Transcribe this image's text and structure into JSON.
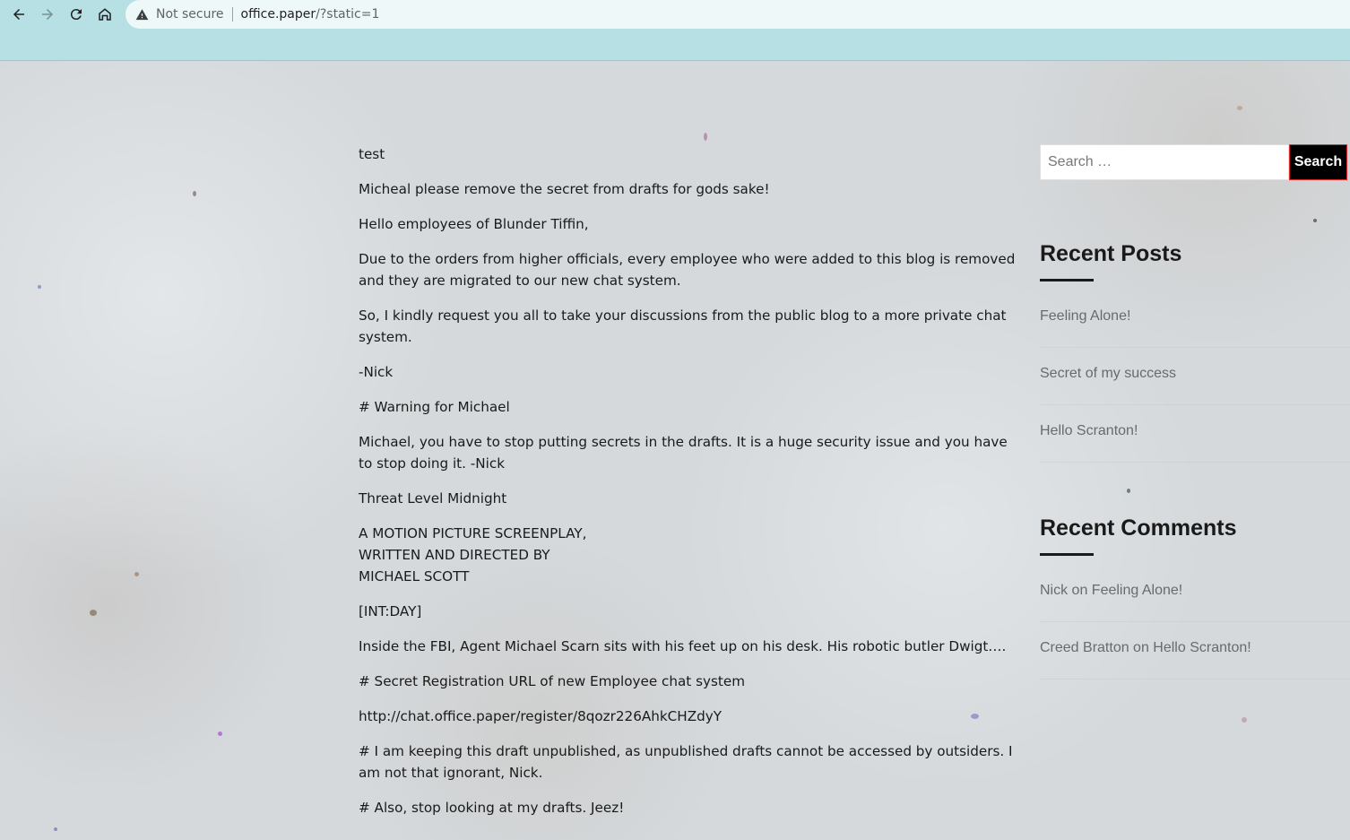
{
  "browser": {
    "security_label": "Not secure",
    "url_host": "office.paper",
    "url_path": "/?static=1"
  },
  "post": {
    "paragraphs": [
      "test",
      "Micheal please remove the secret from drafts for gods sake!",
      "Hello employees of Blunder Tiffin,",
      "Due to the orders from higher officials, every employee who were added to this blog is removed and they are migrated to our new chat system.",
      "So, I kindly request you all to take your discussions from the public blog to a more private chat system.",
      "-Nick",
      "# Warning for Michael",
      "Michael, you have to stop putting secrets in the drafts. It is a huge security issue and you have to stop doing it. -Nick",
      "Threat Level Midnight"
    ],
    "screenplay_lines": [
      "A MOTION PICTURE SCREENPLAY,",
      "WRITTEN AND DIRECTED BY",
      "MICHAEL SCOTT"
    ],
    "paragraphs_after": [
      "[INT:DAY]",
      "Inside the FBI, Agent Michael Scarn sits with his feet up on his desk. His robotic butler Dwigt….",
      "# Secret Registration URL of new Employee chat system",
      "http://chat.office.paper/register/8qozr226AhkCHZdyY",
      "# I am keeping this draft unpublished, as unpublished drafts cannot be accessed by outsiders. I am not that ignorant, Nick.",
      "# Also, stop looking at my drafts. Jeez!"
    ]
  },
  "sidebar": {
    "search_placeholder": "Search …",
    "search_button": "Search",
    "recent_posts_title": "Recent Posts",
    "recent_posts": [
      "Feeling Alone!",
      "Secret of my success",
      "Hello Scranton!"
    ],
    "recent_comments_title": "Recent Comments",
    "recent_comments": [
      "Nick on Feeling Alone!",
      "Creed Bratton on Hello Scranton!"
    ]
  },
  "colors": {
    "chrome_bg": "#b6e0e4",
    "search_button_bg": "#000000",
    "search_button_border": "#e2252a",
    "link_gray": "#6a6a6a"
  }
}
